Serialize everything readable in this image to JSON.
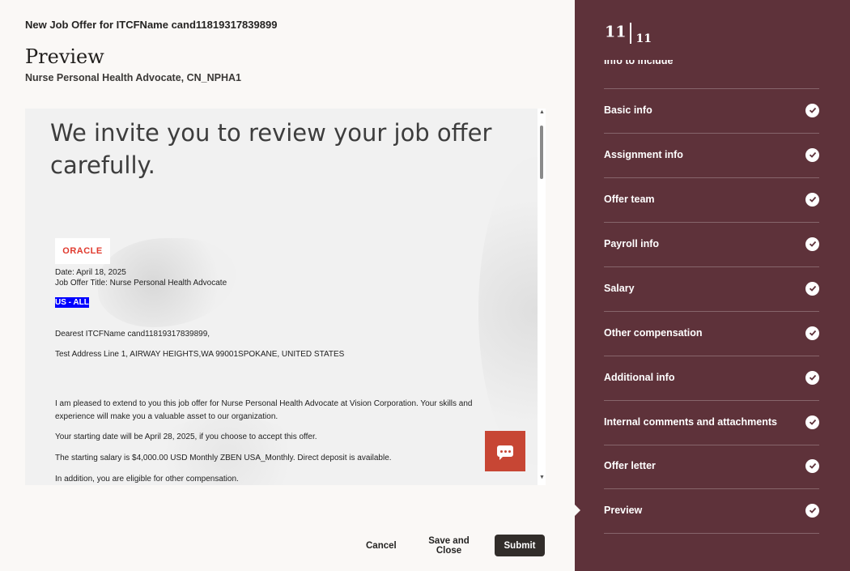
{
  "header": {
    "title": "New Job Offer for ITCFName cand11819317839899",
    "page_title": "Preview",
    "subtitle": "Nurse Personal Health Advocate, CN_NPHA1"
  },
  "letter": {
    "heading": "We invite you to review your job offer carefully.",
    "logo_text": "ORACLE",
    "date": "Date: April 18, 2025",
    "job_title": "Job Offer Title: Nurse Personal Health Advocate",
    "highlight": "US - ALL",
    "salutation": "Dearest ITCFName cand11819317839899,",
    "address": "Test Address Line 1, AIRWAY HEIGHTS,WA 99001SPOKANE, UNITED STATES",
    "para1": "I am pleased to extend to you this job offer for Nurse Personal Health Advocate at Vision Corporation. Your skills and experience will make you a valuable asset to our organization.",
    "para2": "Your starting date will be April 28, 2025, if you choose to accept this offer.",
    "para3": "The starting salary is $4,000.00 USD Monthly ZBEN USA_Monthly. Direct deposit is available.",
    "para4": "In addition, you are eligible for other compensation."
  },
  "footer": {
    "cancel": "Cancel",
    "save_close": "Save and Close",
    "submit": "Submit"
  },
  "steps": {
    "current": "11",
    "total": "11",
    "cutoff_label": "Info to include",
    "items": [
      {
        "label": "Basic info",
        "status": "complete"
      },
      {
        "label": "Assignment info",
        "status": "complete"
      },
      {
        "label": "Offer team",
        "status": "complete"
      },
      {
        "label": "Payroll info",
        "status": "complete"
      },
      {
        "label": "Salary",
        "status": "complete"
      },
      {
        "label": "Other compensation",
        "status": "complete"
      },
      {
        "label": "Additional info",
        "status": "complete"
      },
      {
        "label": "Internal comments and attachments",
        "status": "complete"
      },
      {
        "label": "Offer letter",
        "status": "complete"
      },
      {
        "label": "Preview",
        "status": "complete"
      }
    ]
  },
  "colors": {
    "sidebar_bg": "#5e323a",
    "chat_button": "#c74634",
    "submit_bg": "#312d2a",
    "highlight_bg": "#0000ff"
  },
  "icons": {
    "chat": "chat-bubble-icon",
    "check": "check-circle-icon",
    "scroll_up": "scroll-up-arrow-icon",
    "scroll_down": "scroll-down-arrow-icon"
  }
}
